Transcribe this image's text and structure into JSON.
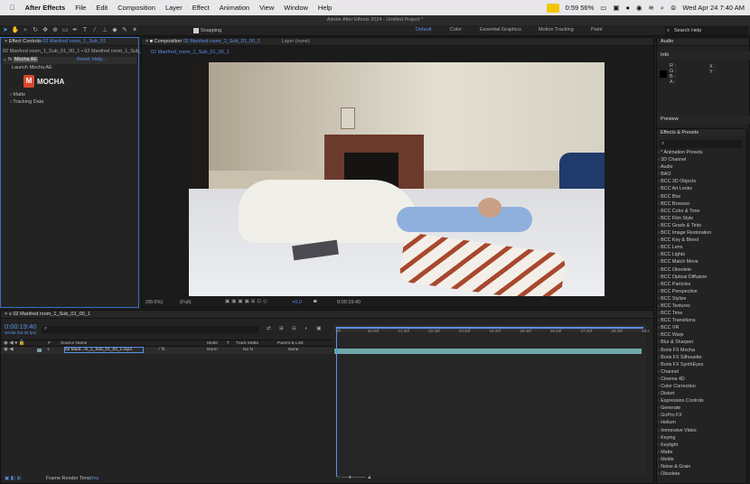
{
  "menubar": {
    "app_name": "After Effects",
    "items": [
      "File",
      "Edit",
      "Composition",
      "Layer",
      "Effect",
      "Animation",
      "View",
      "Window",
      "Help"
    ],
    "battery_status": "0:59 56%",
    "datetime": "Wed Apr 24  7:40 AM"
  },
  "window_title": "Adobe After Effects 2024 - Untitled Project *",
  "toolbar": {
    "snapping_label": "Snapping",
    "workspaces": [
      "Default",
      "Color",
      "Essential Graphics",
      "Motion Tracking",
      "Paint"
    ],
    "search_placeholder": "Search Help"
  },
  "effect_controls": {
    "tab_label": "Effect Controls",
    "tab_layer": "02 Manfred room_1_Sub_01",
    "breadcrumb": "02 Manfred room_1_Sub_01_00_1 • 02 Manfred room_1_Sub_01",
    "effect_name": "Mocha AE",
    "reset_label": "Reset",
    "help_label": "Help...",
    "launch_label": "Launch Mocha AE",
    "logo_text": "MOCHA",
    "sections": [
      "Matte",
      "Tracking Data"
    ]
  },
  "composition": {
    "tab_label": "Composition",
    "tab_name": "02 Manfred room_1_Sub_01_00_1",
    "layer_tab": "Layer (none)",
    "sub_tab": "02 Manfred_room_1_Sub_01_00_1",
    "zoom": "(99.6%)",
    "resolution": "(Full)",
    "exposure": "+0.0",
    "timecode": "0:00:19:40"
  },
  "right_panels": {
    "audio": "Audio",
    "info": "Info",
    "info_labels": [
      "R :",
      "G :",
      "B :",
      "A :"
    ],
    "info_xy": [
      "X :",
      "Y :"
    ],
    "preview": "Preview",
    "effects_presets": "Effects & Presets",
    "effects_list": [
      "* Animation Presets",
      "3D Channel",
      "Audio",
      "BAO",
      "BCC 3D Objects",
      "BCC Art Looks",
      "BCC Blur",
      "BCC Browser",
      "BCC Color & Tone",
      "BCC Film Style",
      "BCC Grads & Tints",
      "BCC Image Restoration",
      "BCC Key & Blend",
      "BCC Lens",
      "BCC Lights",
      "BCC Match Move",
      "BCC Obsolete",
      "BCC Optical Diffusion",
      "BCC Particles",
      "BCC Perspective",
      "BCC Stylize",
      "BCC Textures",
      "BCC Time",
      "BCC Transitions",
      "BCC VR",
      "BCC Warp",
      "Blur & Sharpen",
      "Boris FX Mocha",
      "Boris FX Silhouette",
      "Boris FX SynthEyes",
      "Channel",
      "Cinema 4D",
      "Color Correction",
      "Distort",
      "Expression Controls",
      "Generate",
      "GoPro FX",
      "Helium",
      "Immersive Video",
      "Keying",
      "Keylight",
      "Matte",
      "Mettle",
      "Noise & Grain",
      "Obsolete"
    ]
  },
  "timeline": {
    "tab_name": "02 Manfred room_1_Sub_01_00_1",
    "timecode": "0:00:19:40",
    "frame_info": "00195 (50.00 fps)",
    "columns": [
      "Source Name",
      "Mode",
      "T",
      "Track Matte",
      "Parent & Link"
    ],
    "layer_number": "1",
    "layer_name": "02 Manf...m_1_Sub_01_00_1.mp4",
    "layer_mode": "Norm",
    "layer_matte": "No N",
    "layer_parent": "None",
    "ruler_ticks": [
      "0f",
      "20:40f",
      "21:40f",
      "22:40f",
      "23:40f",
      "24:40f",
      "25:40f",
      "26:40f",
      "27:40f",
      "28:40f",
      "29:4"
    ],
    "frame_render_label": "Frame Render Time",
    "frame_render_value": "2ms"
  }
}
